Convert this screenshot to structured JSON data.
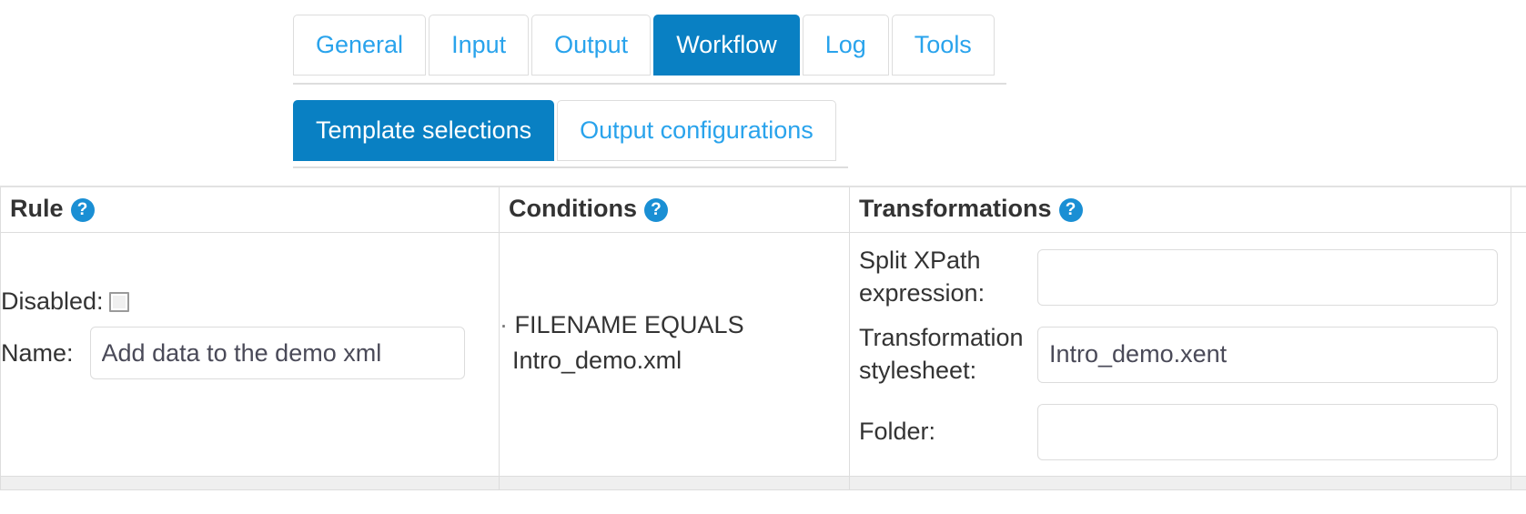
{
  "main_tabs": [
    {
      "label": "General",
      "active": false
    },
    {
      "label": "Input",
      "active": false
    },
    {
      "label": "Output",
      "active": false
    },
    {
      "label": "Workflow",
      "active": true
    },
    {
      "label": "Log",
      "active": false
    },
    {
      "label": "Tools",
      "active": false
    }
  ],
  "sub_tabs": [
    {
      "label": "Template selections",
      "active": true
    },
    {
      "label": "Output configurations",
      "active": false
    }
  ],
  "table": {
    "headers": [
      {
        "label": "Rule",
        "help": "?"
      },
      {
        "label": "Conditions",
        "help": "?"
      },
      {
        "label": "Transformations",
        "help": "?"
      }
    ],
    "row": {
      "rule": {
        "disabled_label": "Disabled:",
        "disabled_checked": false,
        "name_label": "Name:",
        "name_value": "Add data to the demo xml",
        "name_placeholder": ""
      },
      "conditions": {
        "items": [
          {
            "bullet": "·",
            "text": "FILENAME EQUALS Intro_demo.xml"
          }
        ]
      },
      "transformations": {
        "fields": [
          {
            "label": "Split XPath expression:",
            "value": "",
            "placeholder": ""
          },
          {
            "label": "Transformation stylesheet:",
            "value": "Intro_demo.xent",
            "placeholder": ""
          },
          {
            "label": "Folder:",
            "value": "",
            "placeholder": ""
          }
        ]
      }
    }
  },
  "colors": {
    "accent": "#0980c3",
    "link": "#29a3ec",
    "help_badge": "#1a8fd4",
    "border": "#dddddd",
    "row_alt": "#efefef"
  }
}
